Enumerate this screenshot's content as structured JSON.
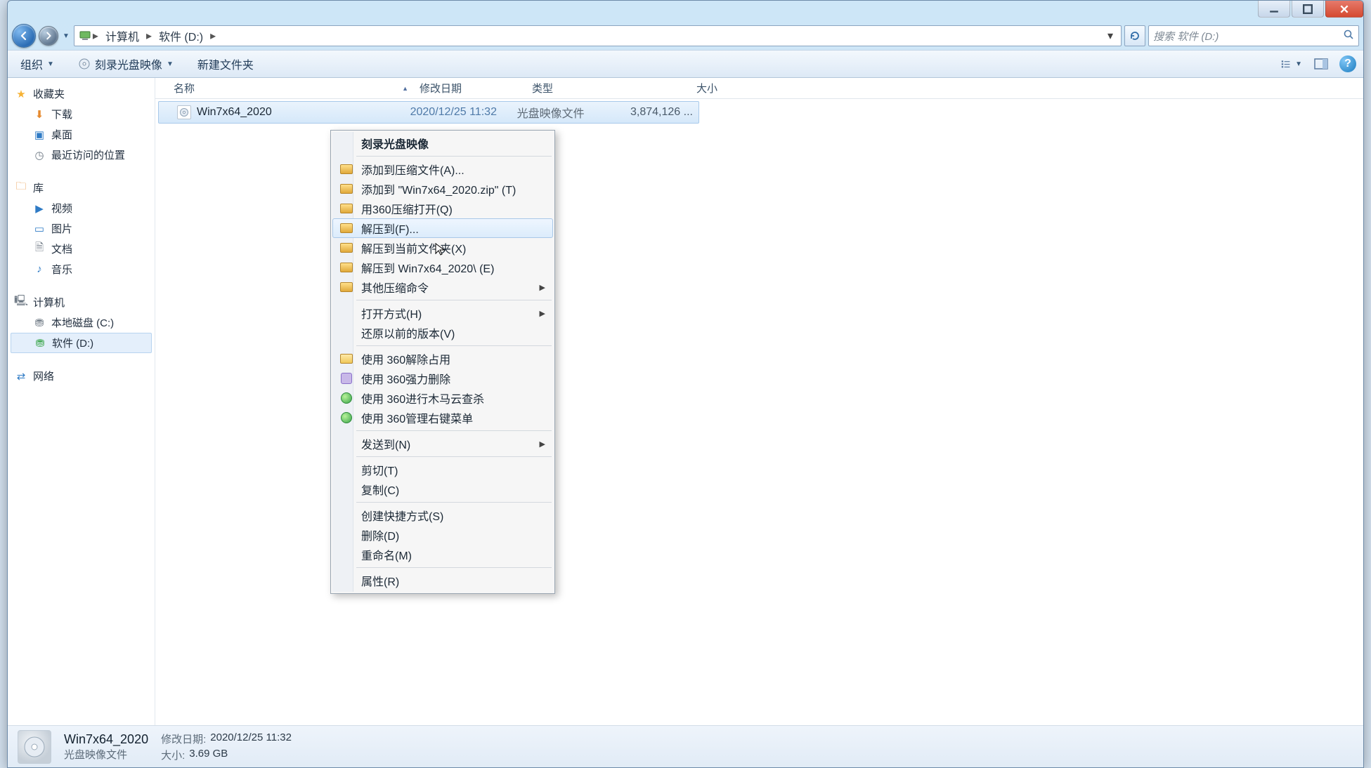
{
  "window_controls": {
    "min": "min",
    "max": "max",
    "close": "close"
  },
  "breadcrumb": {
    "root_icon": "computer-icon",
    "segments": [
      "计算机",
      "软件 (D:)"
    ]
  },
  "search": {
    "placeholder": "搜索 软件 (D:)"
  },
  "toolbar": {
    "organize": "组织",
    "burn": "刻录光盘映像",
    "newfolder": "新建文件夹"
  },
  "sidebar": {
    "favorites": {
      "label": "收藏夹",
      "items": [
        "下载",
        "桌面",
        "最近访问的位置"
      ]
    },
    "libraries": {
      "label": "库",
      "items": [
        "视频",
        "图片",
        "文档",
        "音乐"
      ]
    },
    "computer": {
      "label": "计算机",
      "items": [
        "本地磁盘 (C:)",
        "软件 (D:)"
      ],
      "selected_index": 1
    },
    "network": {
      "label": "网络"
    }
  },
  "columns": {
    "name": "名称",
    "date": "修改日期",
    "type": "类型",
    "size": "大小"
  },
  "rows": [
    {
      "name": "Win7x64_2020",
      "date": "2020/12/25 11:32",
      "type": "光盘映像文件",
      "size": "3,874,126 ...",
      "selected": true
    }
  ],
  "context_menu": {
    "items": [
      {
        "label": "刻录光盘映像",
        "bold": true
      },
      {
        "sep": true
      },
      {
        "label": "添加到压缩文件(A)...",
        "icon": "archive"
      },
      {
        "label": "添加到 \"Win7x64_2020.zip\" (T)",
        "icon": "archive"
      },
      {
        "label": "用360压缩打开(Q)",
        "icon": "archive"
      },
      {
        "label": "解压到(F)...",
        "icon": "archive",
        "hover": true
      },
      {
        "label": "解压到当前文件夹(X)",
        "icon": "archive"
      },
      {
        "label": "解压到 Win7x64_2020\\ (E)",
        "icon": "archive"
      },
      {
        "label": "其他压缩命令",
        "icon": "archive",
        "submenu": true
      },
      {
        "sep": true
      },
      {
        "label": "打开方式(H)",
        "submenu": true
      },
      {
        "label": "还原以前的版本(V)"
      },
      {
        "sep": true
      },
      {
        "label": "使用 360解除占用",
        "icon": "box"
      },
      {
        "label": "使用 360强力删除",
        "icon": "trash"
      },
      {
        "label": "使用 360进行木马云查杀",
        "icon": "green"
      },
      {
        "label": "使用 360管理右键菜单",
        "icon": "green"
      },
      {
        "sep": true
      },
      {
        "label": "发送到(N)",
        "submenu": true
      },
      {
        "sep": true
      },
      {
        "label": "剪切(T)"
      },
      {
        "label": "复制(C)"
      },
      {
        "sep": true
      },
      {
        "label": "创建快捷方式(S)"
      },
      {
        "label": "删除(D)"
      },
      {
        "label": "重命名(M)"
      },
      {
        "sep": true
      },
      {
        "label": "属性(R)"
      }
    ]
  },
  "details": {
    "name": "Win7x64_2020",
    "type": "光盘映像文件",
    "date_label": "修改日期:",
    "date": "2020/12/25 11:32",
    "size_label": "大小:",
    "size": "3.69 GB"
  }
}
